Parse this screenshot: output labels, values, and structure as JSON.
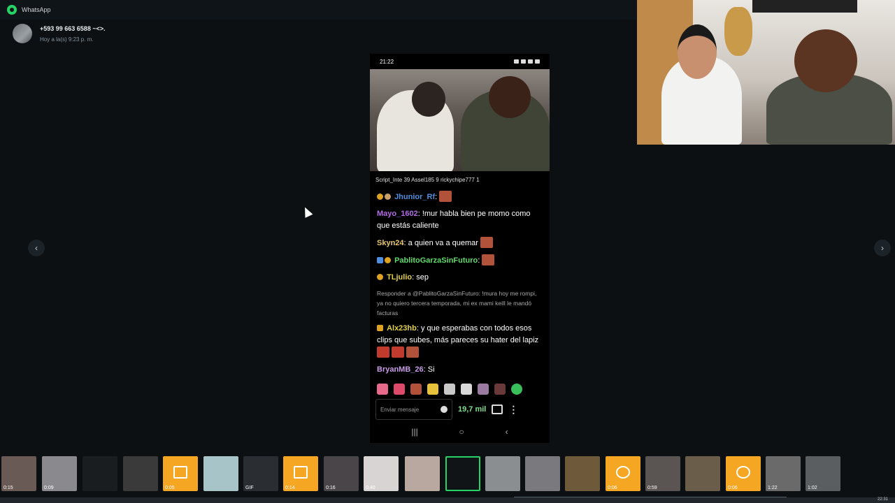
{
  "app": {
    "title": "WhatsApp"
  },
  "sender": {
    "name": "+593 99 663 6588 ~<>.",
    "time": "Hoy a la(s) 9:23 p. m."
  },
  "phone": {
    "status_time": "21:22",
    "viewers": "Script_Inte 39  Assel185   9  rickychipe777  1",
    "chat": [
      {
        "user": "Jhunior_Rf",
        "text": ":",
        "color": "#4e8fe0"
      },
      {
        "user": "Mayo_1602",
        "text": ": !mur habla bien pe momo como que estás caliente",
        "color": "#b56ce6"
      },
      {
        "user": "Skyn24",
        "text": ": a quien va a quemar",
        "color": "#e8c66a"
      },
      {
        "user": "PablitoGarzaSinFuturo",
        "text": ":",
        "color": "#5fd96a"
      },
      {
        "user": "TLjulio",
        "text": ": sep",
        "color": "#e2d04a"
      },
      {
        "reply": "Responder a @PablitoGarzaSinFuturo: !mura hoy me rompi, ya no quiero tercera temporada, mi ex mami keill le mandó facturas"
      },
      {
        "user": "Alx23hb",
        "text": ": y que esperabas con todos esos clips que subes, más pareces su hater del lapiz",
        "color": "#e0d04a"
      },
      {
        "user": "BryanMB_26",
        "text": ": Si",
        "color": "#c89be8"
      }
    ],
    "input_placeholder": "Enviar mensaje",
    "viewer_count": "19,7 mil"
  },
  "nav": {
    "prev": "‹",
    "next": "›"
  },
  "thumbs": [
    {
      "label": "0:15"
    },
    {
      "label": "0:09"
    },
    {
      "label": ""
    },
    {
      "label": ""
    },
    {
      "label": "0:05"
    },
    {
      "label": ""
    },
    {
      "label": "GIF"
    },
    {
      "label": "0:14"
    },
    {
      "label": "0:16"
    },
    {
      "label": "0:40"
    },
    {
      "label": ""
    },
    {
      "label": ""
    },
    {
      "label": ""
    },
    {
      "label": ""
    },
    {
      "label": ""
    },
    {
      "label": "0:06"
    },
    {
      "label": "0:59"
    },
    {
      "label": ""
    },
    {
      "label": "0:06"
    },
    {
      "label": "1:22"
    },
    {
      "label": "1:02"
    }
  ],
  "taskbar": {
    "clock": "22:31"
  }
}
